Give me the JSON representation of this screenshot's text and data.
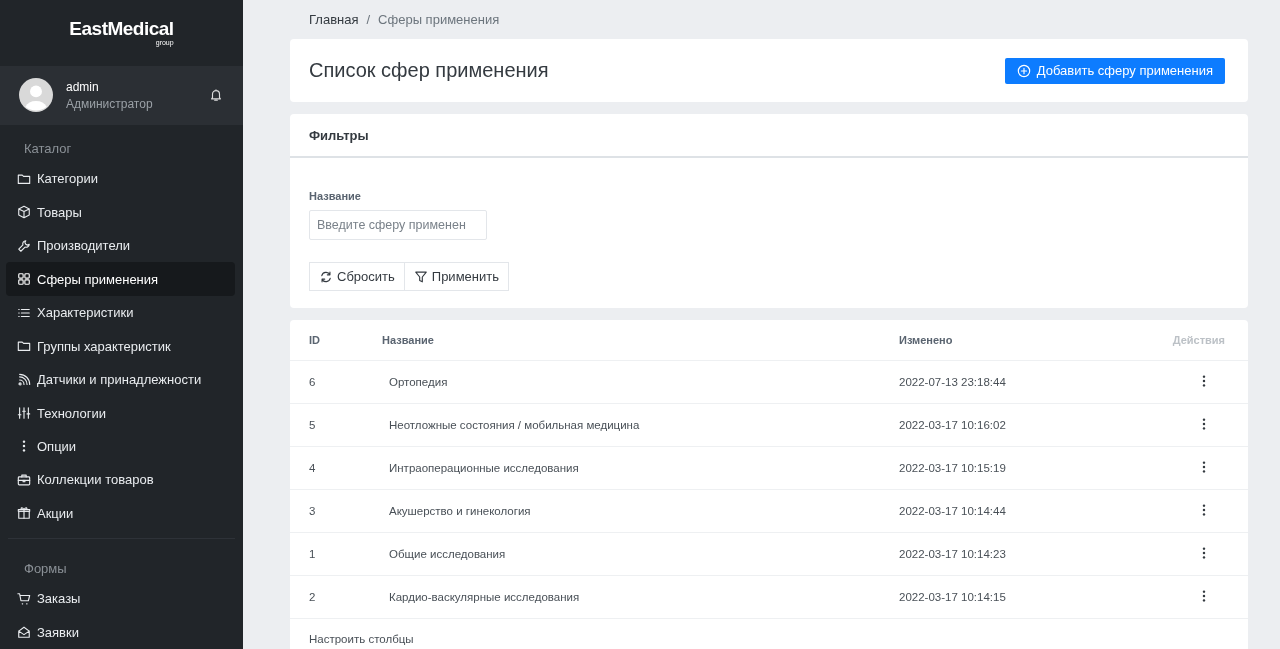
{
  "sidebar": {
    "logo": {
      "name": "EastMedical",
      "tagline": "group"
    },
    "user": {
      "name": "admin",
      "role": "Администратор"
    },
    "sections": [
      {
        "title": "Каталог",
        "items": [
          {
            "label": "Категории",
            "selected": false
          },
          {
            "label": "Товары",
            "selected": false
          },
          {
            "label": "Производители",
            "selected": false
          },
          {
            "label": "Сферы применения",
            "selected": true
          },
          {
            "label": "Характеристики",
            "selected": false
          },
          {
            "label": "Группы характеристик",
            "selected": false
          },
          {
            "label": "Датчики и принадлежности",
            "selected": false
          },
          {
            "label": "Технологии",
            "selected": false
          },
          {
            "label": "Опции",
            "selected": false
          },
          {
            "label": "Коллекции товаров",
            "selected": false
          },
          {
            "label": "Акции",
            "selected": false
          }
        ]
      },
      {
        "title": "Формы",
        "items": [
          {
            "label": "Заказы",
            "selected": false
          },
          {
            "label": "Заявки",
            "selected": false
          }
        ]
      }
    ]
  },
  "breadcrumb": [
    "Главная",
    "Сферы применения"
  ],
  "breadcrumb_separator": "/",
  "header": {
    "title": "Список сфер применения",
    "add_button": "Добавить сферу применения"
  },
  "filters": {
    "title": "Фильтры",
    "field": {
      "label": "Название",
      "placeholder": "Введите сферу применен"
    },
    "buttons": [
      "Сбросить",
      "Применить"
    ]
  },
  "table": {
    "columns": [
      "ID",
      "Название",
      "Изменено",
      "Действия"
    ],
    "rows": [
      {
        "id": "6",
        "name": "Ортопедия",
        "modified": "2022-07-13 23:18:44"
      },
      {
        "id": "5",
        "name": "Неотложные состояния / мобильная медицина",
        "modified": "2022-03-17 10:16:02"
      },
      {
        "id": "4",
        "name": "Интраоперационные исследования",
        "modified": "2022-03-17 10:15:19"
      },
      {
        "id": "3",
        "name": "Акушерство и гинекология",
        "modified": "2022-03-17 10:14:44"
      },
      {
        "id": "1",
        "name": "Общие исследования",
        "modified": "2022-03-17 10:14:23"
      },
      {
        "id": "2",
        "name": "Кардио-васкулярные исследования",
        "modified": "2022-03-17 10:14:15"
      }
    ],
    "footer_link": "Настроить столбцы"
  }
}
